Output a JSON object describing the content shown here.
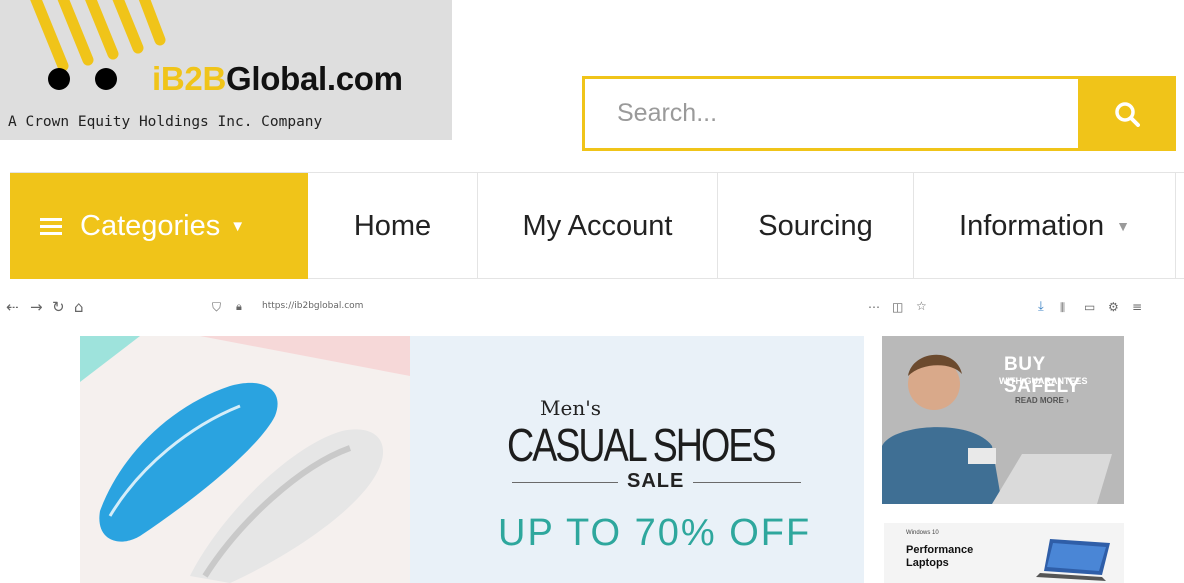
{
  "header": {
    "logo": {
      "brand_prefix": "iB2B",
      "brand_suffix": "Global.com",
      "tagline": "A Crown Equity Holdings Inc. Company"
    },
    "search": {
      "placeholder": "Search..."
    }
  },
  "nav": {
    "categories_label": "Categories",
    "items": [
      {
        "label": "Home"
      },
      {
        "label": "My Account"
      },
      {
        "label": "Sourcing"
      },
      {
        "label": "Information"
      }
    ]
  },
  "browser_bar": {
    "url": "https://ib2bglobal.com"
  },
  "banner": {
    "line1": "Men's",
    "line2": "CASUAL SHOES",
    "line3": "SALE",
    "line4": "UP TO 70% OFF"
  },
  "side_ads": {
    "ad1": {
      "title": "BUY SAFELY",
      "subtitle": "WITH GUARANTEES",
      "link": "READ MORE ›"
    },
    "ad2": {
      "brand": "Windows 10",
      "title": "Performance Laptops"
    }
  },
  "colors": {
    "accent": "#f0c419",
    "teal": "#2ea79d"
  }
}
